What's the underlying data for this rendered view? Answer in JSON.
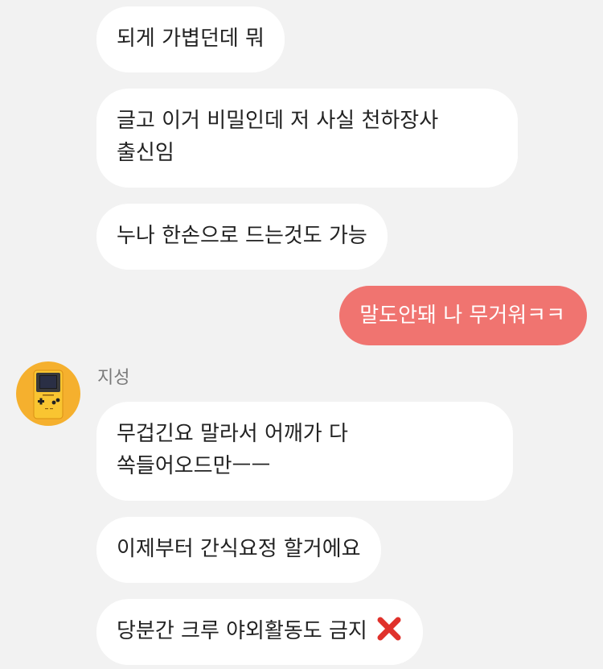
{
  "chat": {
    "messages": [
      {
        "text": "되게 가볍던데 뭐"
      },
      {
        "text": "글고 이거 비밀인데 저 사실 천하장사 출신임"
      },
      {
        "text": "누나 한손으로 드는것도 가능"
      },
      {
        "text": "말도안돼 나 무거워ㅋㅋ"
      },
      {
        "text": "무겁긴요 말라서 어깨가 다 쏙들어오드만ㅡㅡ"
      },
      {
        "text": "이제부터 간식요정 할거에요"
      },
      {
        "text": "당분간 크루 야외활동도 금지"
      }
    ],
    "sender_name": "지성",
    "avatar_icon": "gameboy-icon",
    "emoji_icon": "cross-mark-icon",
    "colors": {
      "background": "#f2f2f2",
      "incoming_bubble": "#ffffff",
      "outgoing_bubble": "#f07470",
      "avatar": "#f5b02e",
      "emoji": "#e0312b"
    }
  }
}
